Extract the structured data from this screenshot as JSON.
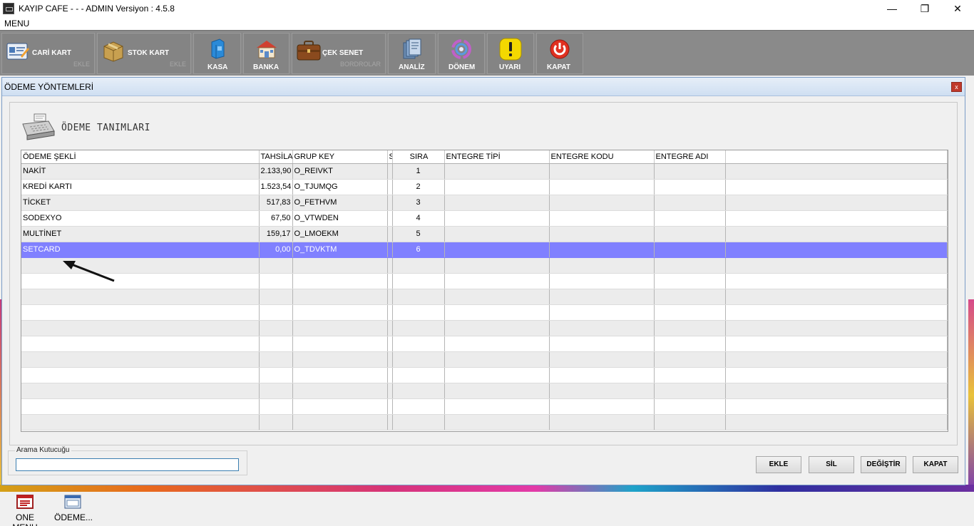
{
  "window": {
    "title": "KAYIP CAFE -  -  - ADMIN   Versiyon : 4.5.8",
    "menu_label": "MENU"
  },
  "toolbar": {
    "cari_kart": "CARİ KART",
    "cari_sub": "EKLE",
    "stok_kart": "STOK KART",
    "stok_sub": "EKLE",
    "kasa": "KASA",
    "banka": "BANKA",
    "cek_senet": "ÇEK SENET",
    "cek_sub": "BORDROLAR",
    "analiz": "ANALİZ",
    "donem": "DÖNEM",
    "uyari": "UYARI",
    "kapat": "KAPAT"
  },
  "dialog": {
    "title": "ÖDEME YÖNTEMLERİ",
    "close": "x",
    "panel_title": "ÖDEME TANIMLARI"
  },
  "grid": {
    "columns": [
      "ÖDEME ŞEKLİ",
      "TAHSİLA",
      "GRUP KEY",
      "S",
      "SIRA",
      "ENTEGRE TİPİ",
      "ENTEGRE KODU",
      "ENTEGRE ADI",
      ""
    ],
    "rows": [
      {
        "odeme": "NAKİT",
        "tahsilat": "2.133,90",
        "grup": "O_REIVKT",
        "sira": "1"
      },
      {
        "odeme": "KREDİ KARTI",
        "tahsilat": "1.523,54",
        "grup": "O_TJUMQG",
        "sira": "2"
      },
      {
        "odeme": "TİCKET",
        "tahsilat": "517,83",
        "grup": "O_FETHVM",
        "sira": "3"
      },
      {
        "odeme": "SODEXYO",
        "tahsilat": "67,50",
        "grup": "O_VTWDEN",
        "sira": "4"
      },
      {
        "odeme": "MULTİNET",
        "tahsilat": "159,17",
        "grup": "O_LMOEKM",
        "sira": "5"
      },
      {
        "odeme": "SETCARD",
        "tahsilat": "0,00",
        "grup": "O_TDVKTM",
        "sira": "6"
      }
    ],
    "selected_row": 5
  },
  "search": {
    "label": "Arama Kutucuğu",
    "value": ""
  },
  "buttons": {
    "ekle": "EKLE",
    "sil": "SİL",
    "degistir": "DEĞİŞTİR",
    "kapat": "KAPAT"
  },
  "taskbar": {
    "item1": "ONE MENU",
    "item2": "ÖDEME..."
  },
  "colors": {
    "selected_row": "#8080ff",
    "toolbar_bg": "#8a8a8a"
  }
}
